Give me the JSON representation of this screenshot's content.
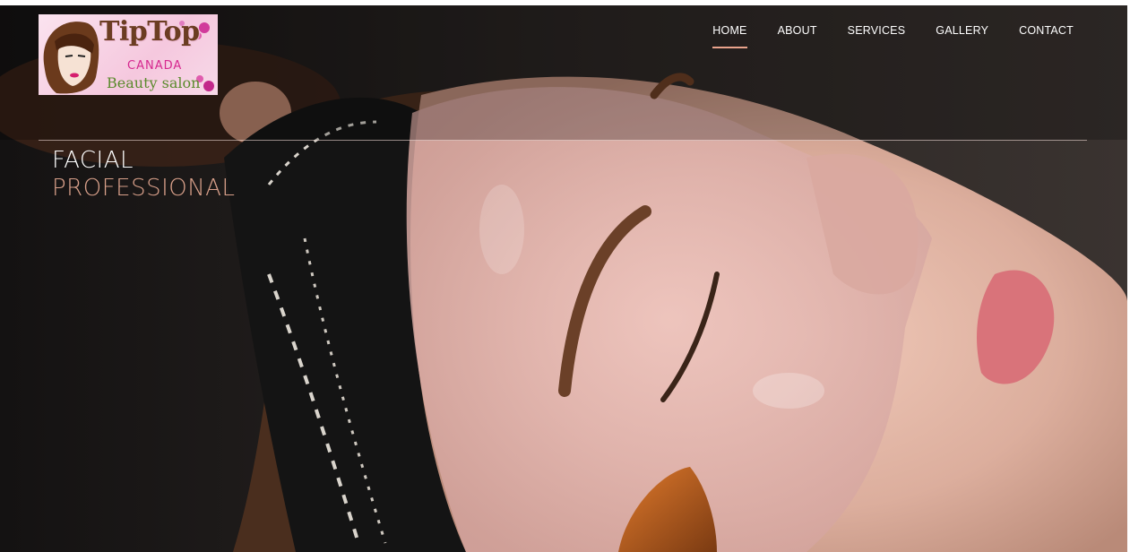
{
  "logo": {
    "name": "TipTop",
    "country": "CANADA",
    "tagline": "Beauty salon"
  },
  "nav": {
    "items": [
      {
        "label": "HOME",
        "active": true
      },
      {
        "label": "ABOUT",
        "active": false
      },
      {
        "label": "SERVICES",
        "active": false
      },
      {
        "label": "GALLERY",
        "active": false
      },
      {
        "label": "CONTACT",
        "active": false
      }
    ]
  },
  "hero": {
    "line1": "FACIAL",
    "line2": "PROFESSIONAL"
  },
  "colors": {
    "accent": "#e9a38c",
    "headline_secondary": "#d9a08a",
    "nav_text": "#ffffff"
  }
}
